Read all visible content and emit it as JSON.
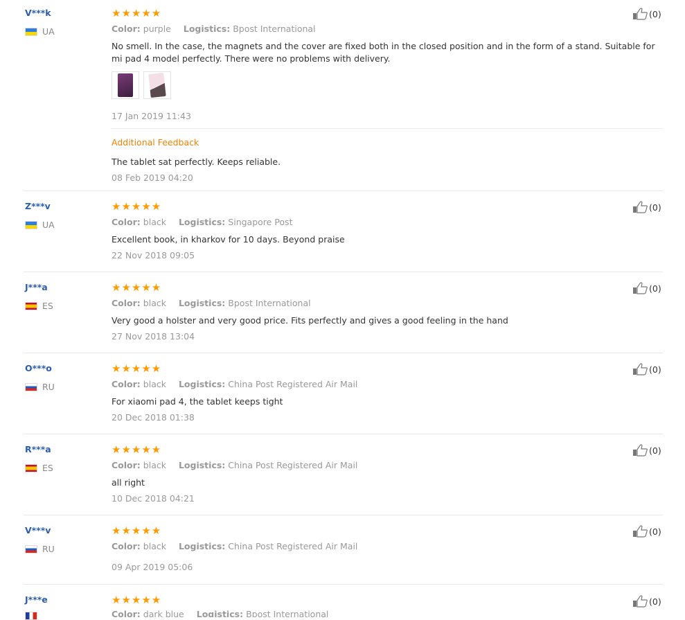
{
  "labels": {
    "color": "Color:",
    "logistics": "Logistics:",
    "additional_feedback": "Additional Feedback"
  },
  "reviews": [
    {
      "user": "V***k",
      "country": "UA",
      "rating": 5,
      "color": "purple",
      "logistics": "Bpost International",
      "text": "No smell. In the case, the magnets and the cover are fixed both in the closed position and in the form of a stand. Suitable for mi pad 4 model perfectly. There were no problems with delivery.",
      "date": "17 Jan 2019 11:43",
      "helpful": "(0)",
      "photos": 2,
      "additional": {
        "text": "The tablet sat perfectly. Keeps reliable.",
        "date": "08 Feb 2019 04:20"
      }
    },
    {
      "user": "Z***v",
      "country": "UA",
      "rating": 5,
      "color": "black",
      "logistics": "Singapore Post",
      "text": "Excellent book, in kharkov for 10 days. Beyond praise",
      "date": "22 Nov 2018 09:05",
      "helpful": "(0)"
    },
    {
      "user": "J***a",
      "country": "ES",
      "rating": 5,
      "color": "black",
      "logistics": "Bpost International",
      "text": "Very good a holster and very good price. Fits perfectly and gives a good feeling in the hand",
      "date": "27 Nov 2018 13:04",
      "helpful": "(0)"
    },
    {
      "user": "O***o",
      "country": "RU",
      "rating": 5,
      "color": "black",
      "logistics": "China Post Registered Air Mail",
      "text": "For xiaomi pad 4, the tablet keeps tight",
      "date": "20 Dec 2018 01:38",
      "helpful": "(0)"
    },
    {
      "user": "R***a",
      "country": "ES",
      "rating": 5,
      "color": "black",
      "logistics": "China Post Registered Air Mail",
      "text": "all right",
      "date": "10 Dec 2018 04:21",
      "helpful": "(0)"
    },
    {
      "user": "V***v",
      "country": "RU",
      "rating": 5,
      "color": "black",
      "logistics": "China Post Registered Air Mail",
      "text": "",
      "date": "09 Apr 2019 05:06",
      "helpful": "(0)"
    },
    {
      "user": "J***e",
      "country": "FR",
      "rating": 5,
      "color": "dark blue",
      "logistics": "Bpost International",
      "helpful": "(0)"
    }
  ],
  "icons": {
    "rating": "star-icon",
    "helpful": "thumbs-up-icon",
    "country": "flag-icon"
  },
  "colors": {
    "username": "#2a5db0",
    "stars": "#ff9a00",
    "additional_feedback": "#f08200"
  }
}
